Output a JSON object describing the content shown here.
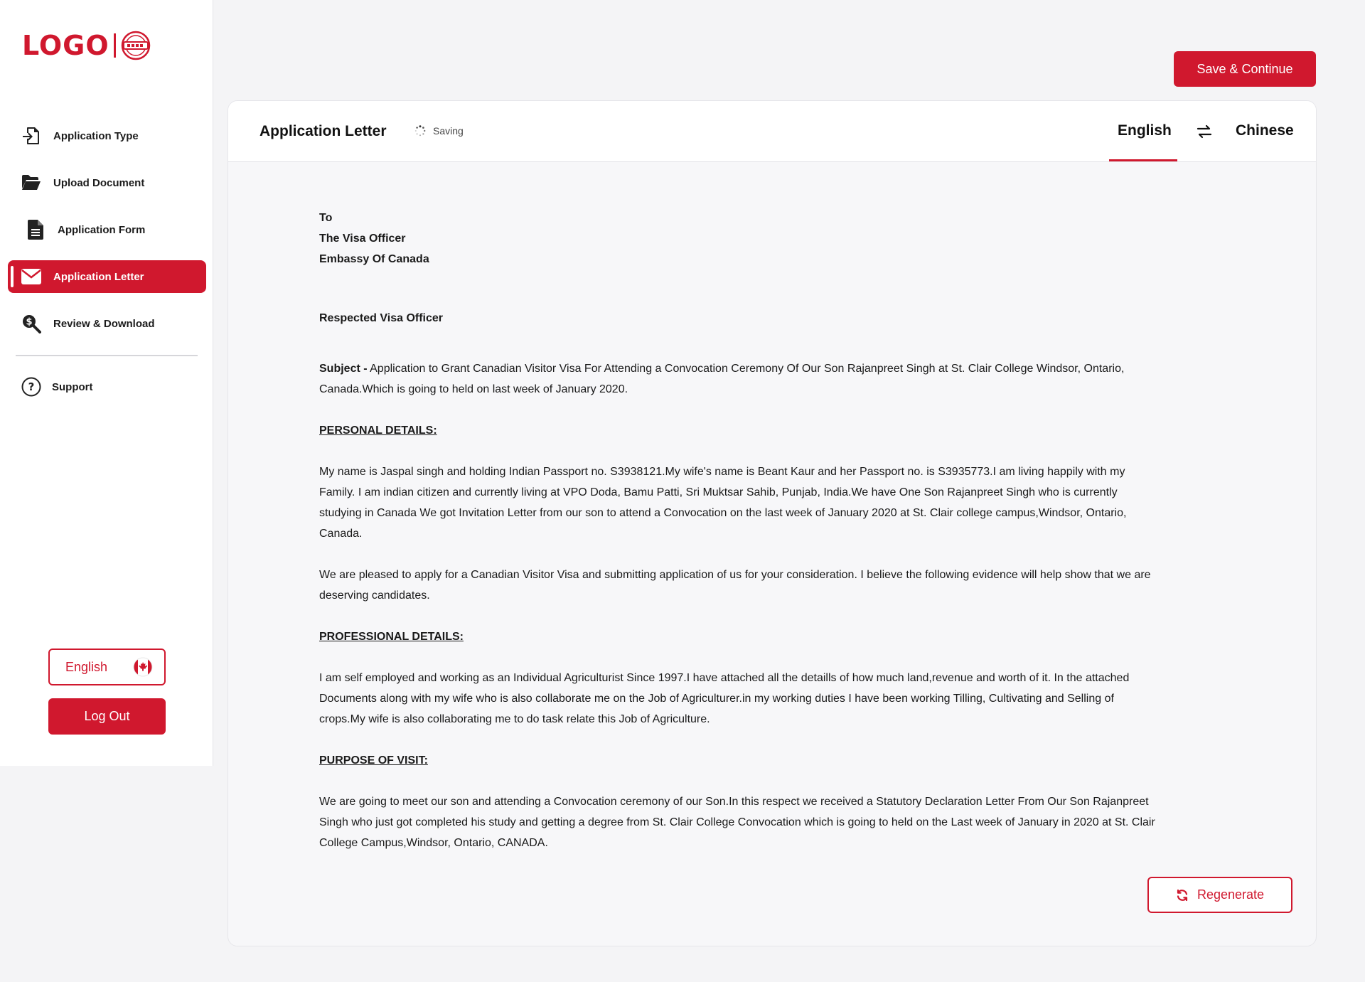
{
  "brand": {
    "logo_text": "LOGO",
    "accent": "#d0182e"
  },
  "sidebar": {
    "items": [
      {
        "label": "Application Type",
        "icon": "file-import-icon"
      },
      {
        "label": "Upload Document",
        "icon": "folder-open-icon"
      },
      {
        "label": "Application Form",
        "icon": "file-text-icon"
      },
      {
        "label": "Application Letter",
        "icon": "envelope-icon",
        "active": true
      },
      {
        "label": "Review & Download",
        "icon": "search-dollar-icon"
      }
    ],
    "support": {
      "label": "Support",
      "icon": "question-circle-icon"
    },
    "language_button": {
      "label": "English",
      "icon": "canada-flag-icon"
    },
    "logout_label": "Log Out"
  },
  "toolbar": {
    "save_label": "Save & Continue"
  },
  "card": {
    "title": "Application Letter",
    "status": "Saving",
    "tabs": {
      "english": "English",
      "chinese": "Chinese",
      "active": "English"
    },
    "regenerate_label": "Regenerate"
  },
  "letter": {
    "to": "To",
    "recipient": "The Visa Officer",
    "embassy": "Embassy Of Canada",
    "salutation": "Respected Visa Officer",
    "subject_label": "Subject -",
    "subject_text": " Application to Grant Canadian Visitor Visa For Attending a Convocation Ceremony Of Our Son Rajanpreet Singh at St. Clair College Windsor, Ontario, Canada.Which is going to held on last week of January 2020.",
    "personal_heading": "PERSONAL DETAILS:",
    "personal_text": "My name is Jaspal singh and holding Indian Passport no. S3938121.My wife's name is Beant Kaur and her Passport no. is S3935773.I am living happily with my Family. I am indian citizen and currently living at VPO Doda, Bamu Patti, Sri Muktsar Sahib, Punjab, India.We have One Son Rajanpreet Singh who is currently studying in Canada We got Invitation Letter from our son to attend a Convocation on the last week of January 2020 at St. Clair college campus,Windsor, Ontario, Canada.",
    "apply_text": "We are pleased to apply for a Canadian Visitor Visa and submitting application of us for your consideration. I believe the following evidence will help show that we are deserving candidates.",
    "professional_heading": "PROFESSIONAL DETAILS:",
    "professional_text": "I am self employed and working as an Individual Agriculturist Since 1997.I have attached all the detaills of how much land,revenue and worth of it. In the attached Documents along with my wife who is also collaborate me on the Job of Agriculturer.in my working duties I have been working Tilling, Cultivating and Selling of crops.My wife is also collaborating me to do task relate this Job of Agriculture.",
    "purpose_heading": "PURPOSE OF VISIT:",
    "purpose_text": "We are going to meet our son and attending a Convocation ceremony of our Son.In this respect we received a Statutory Declaration Letter From Our Son Rajanpreet Singh who just got completed his study and getting a degree from St. Clair College Convocation which is going to held on the Last week of January in 2020 at St. Clair College Campus,Windsor, Ontario, CANADA."
  }
}
